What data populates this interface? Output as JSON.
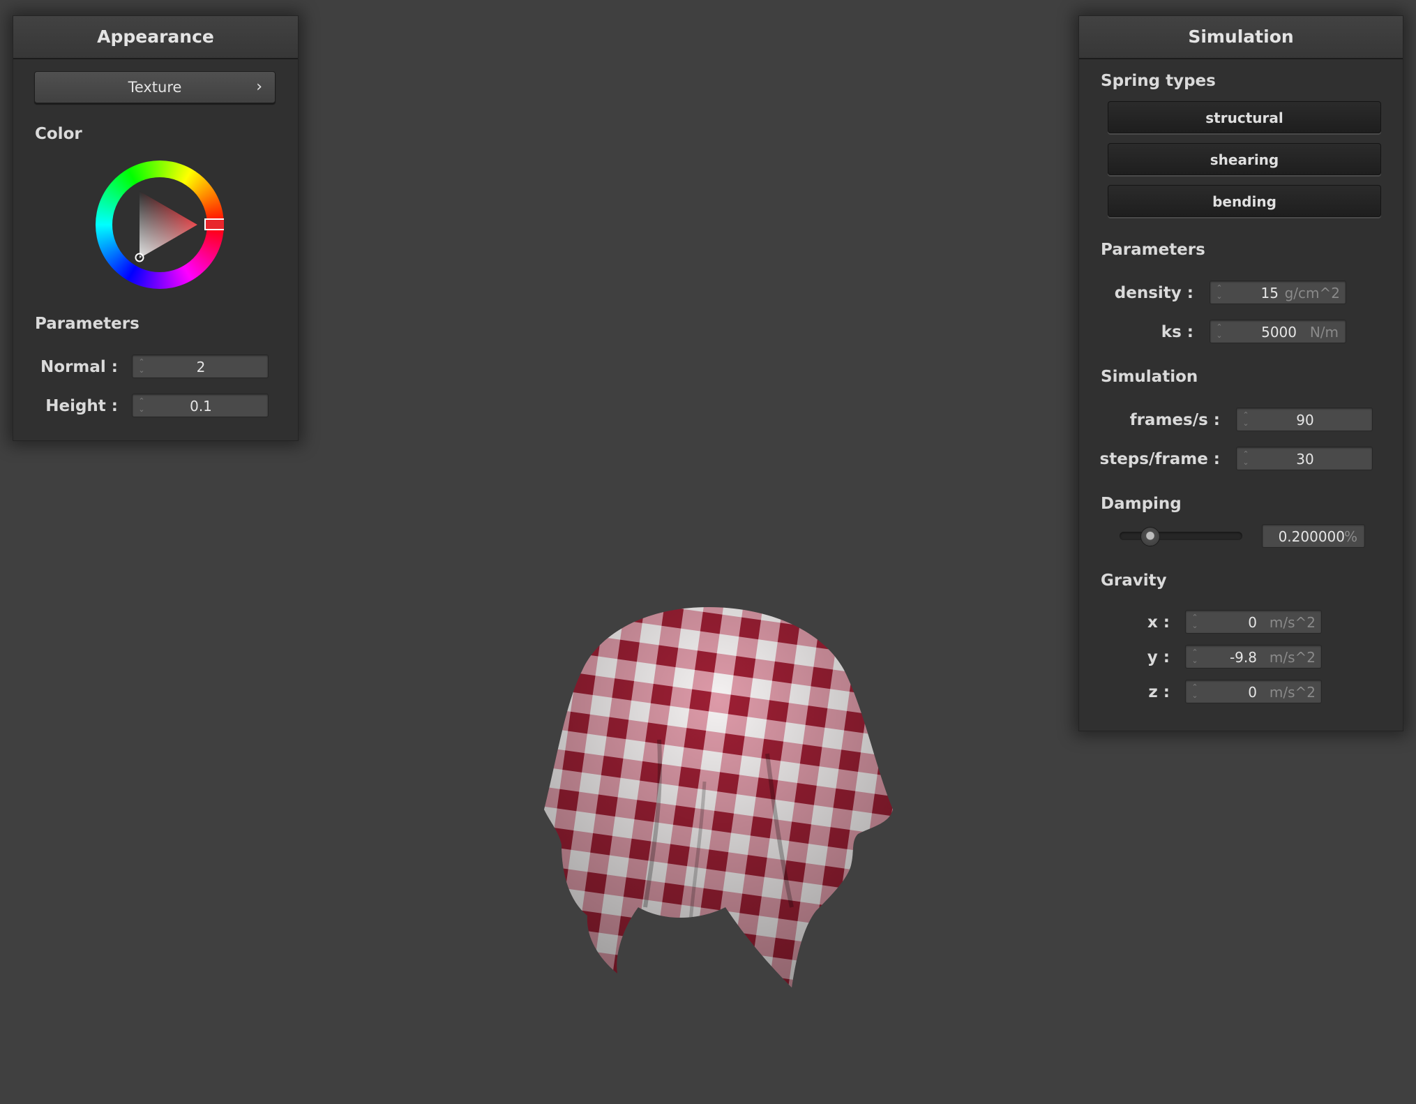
{
  "appearance": {
    "title": "Appearance",
    "texture_button": "Texture",
    "texture_chevron": "›",
    "color_label": "Color",
    "color": {
      "hue": "#e8262c",
      "selected": "#c2222a"
    },
    "params_label": "Parameters",
    "normal": {
      "label": "Normal :",
      "value": "2"
    },
    "height": {
      "label": "Height :",
      "value": "0.1"
    }
  },
  "simulation": {
    "title": "Simulation",
    "spring_types_label": "Spring types",
    "springs": [
      "structural",
      "shearing",
      "bending"
    ],
    "params_label": "Parameters",
    "density": {
      "label": "density :",
      "value": "15",
      "unit": "g/cm^2"
    },
    "ks": {
      "label": "ks :",
      "value": "5000",
      "unit": "N/m"
    },
    "sim_label": "Simulation",
    "fps": {
      "label": "frames/s :",
      "value": "90"
    },
    "steps": {
      "label": "steps/frame :",
      "value": "30"
    },
    "damping_label": "Damping",
    "damping": {
      "value": "0.200000",
      "unit": "%",
      "slider_fraction": 0.2
    },
    "gravity_label": "Gravity",
    "gx": {
      "label": "x :",
      "value": "0",
      "unit": "m/s^2"
    },
    "gy": {
      "label": "y :",
      "value": "-9.8",
      "unit": "m/s^2"
    },
    "gz": {
      "label": "z :",
      "value": "0",
      "unit": "m/s^2"
    }
  },
  "scene": {
    "cloth_colors": {
      "red": "#9c1f34",
      "pink": "#e0a0ae",
      "white": "#f4f1f1"
    }
  }
}
